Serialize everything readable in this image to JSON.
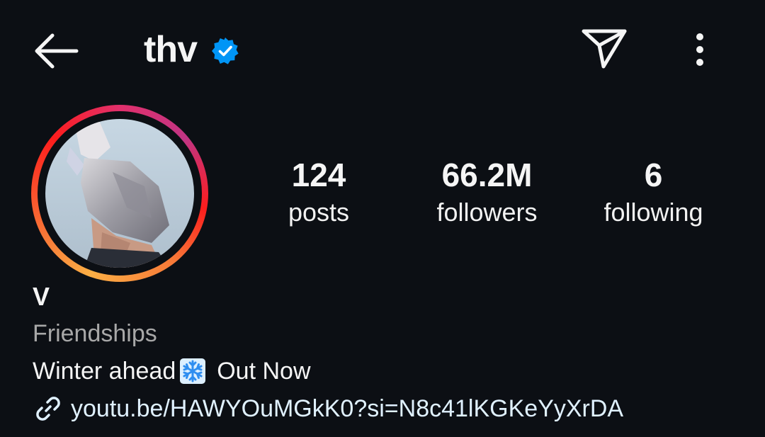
{
  "header": {
    "username": "thv",
    "verified": true
  },
  "stats": {
    "posts_count": "124",
    "posts_label": "posts",
    "followers_count": "66.2M",
    "followers_label": "followers",
    "following_count": "6",
    "following_label": "following"
  },
  "bio": {
    "display_name": "V",
    "category": "Friendships",
    "text": "Winter ahead",
    "text_after_emoji": "Out Now",
    "emoji": "snowflake-icon",
    "link": "youtu.be/HAWYOuMGkK0?si=N8c41lKGKeYyXrDA"
  },
  "icons": {
    "back": "arrow-left-icon",
    "verified": "verified-badge-icon",
    "send": "paper-plane-icon",
    "more": "more-vertical-icon",
    "link": "link-icon"
  },
  "colors": {
    "background": "#0c0f14",
    "text": "#f5f5f5",
    "muted": "#a8a8a8",
    "link": "#e0f1ff",
    "verified": "#0095f6"
  }
}
